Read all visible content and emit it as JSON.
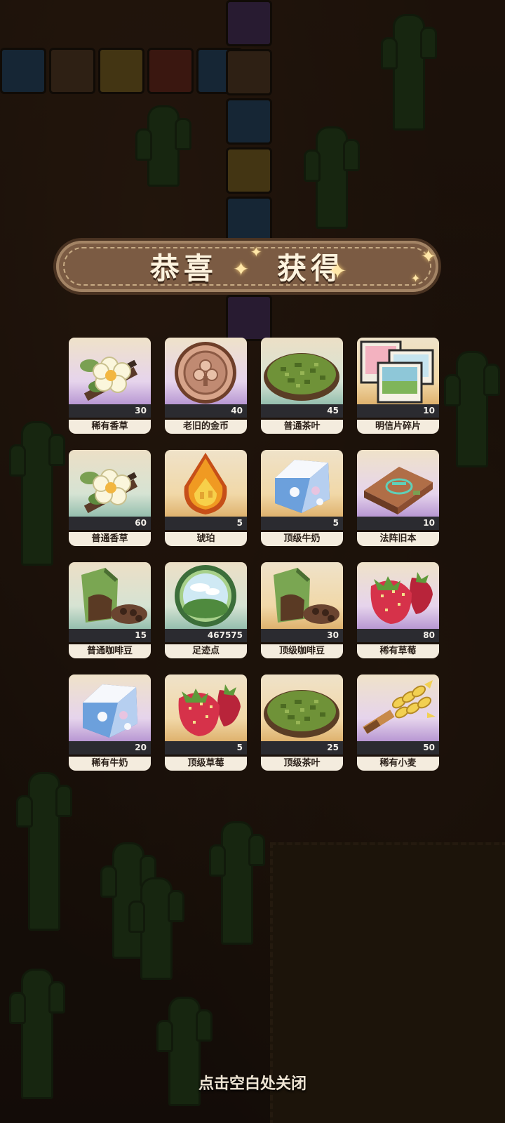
{
  "popup": {
    "title_left": "恭喜",
    "title_right": "获得",
    "close_hint": "点击空白处关闭"
  },
  "rewards": [
    {
      "name": "稀有香草",
      "qty": "30",
      "icon": "vanilla-flower-icon",
      "rarity": "purple"
    },
    {
      "name": "老旧的金币",
      "qty": "40",
      "icon": "old-coin-icon",
      "rarity": "purple"
    },
    {
      "name": "普通茶叶",
      "qty": "45",
      "icon": "tea-leaves-icon",
      "rarity": "teal"
    },
    {
      "name": "明信片碎片",
      "qty": "10",
      "icon": "postcard-fragment-icon",
      "rarity": "gold"
    },
    {
      "name": "普通香草",
      "qty": "60",
      "icon": "vanilla-flower-icon",
      "rarity": "teal"
    },
    {
      "name": "琥珀",
      "qty": "5",
      "icon": "amber-icon",
      "rarity": "gold"
    },
    {
      "name": "顶级牛奶",
      "qty": "5",
      "icon": "milk-carton-icon",
      "rarity": "gold"
    },
    {
      "name": "法阵旧本",
      "qty": "10",
      "icon": "old-spellbook-icon",
      "rarity": "purple"
    },
    {
      "name": "普通咖啡豆",
      "qty": "15",
      "icon": "coffee-bag-icon",
      "rarity": "teal"
    },
    {
      "name": "足迹点",
      "qty": "467575",
      "icon": "footprint-orb-icon",
      "rarity": "teal"
    },
    {
      "name": "顶级咖啡豆",
      "qty": "30",
      "icon": "coffee-bag-icon",
      "rarity": "gold"
    },
    {
      "name": "稀有草莓",
      "qty": "80",
      "icon": "strawberry-icon",
      "rarity": "purple"
    },
    {
      "name": "稀有牛奶",
      "qty": "20",
      "icon": "milk-carton-icon",
      "rarity": "purple"
    },
    {
      "name": "顶级草莓",
      "qty": "5",
      "icon": "strawberry-icon",
      "rarity": "gold"
    },
    {
      "name": "顶级茶叶",
      "qty": "25",
      "icon": "tea-leaves-icon",
      "rarity": "gold"
    },
    {
      "name": "稀有小麦",
      "qty": "50",
      "icon": "wheat-icon",
      "rarity": "purple"
    }
  ],
  "colors": {
    "banner": "#7b5b43",
    "label_bg": "#f4ecde",
    "qty_bar": "#2b2b30",
    "rarity_purple": "#9d74c4",
    "rarity_teal": "#6fa998",
    "rarity_gold": "#d49c4c"
  }
}
